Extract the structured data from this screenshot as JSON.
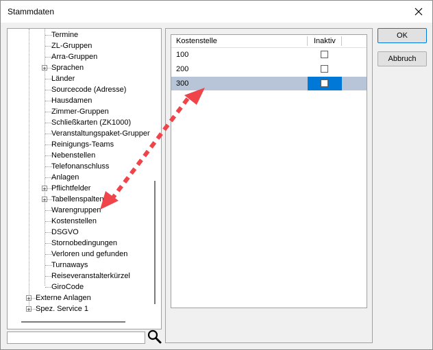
{
  "window": {
    "title": "Stammdaten"
  },
  "tree": {
    "items": [
      {
        "label": "Termine",
        "level": 2,
        "expander": false
      },
      {
        "label": "ZL-Gruppen",
        "level": 2,
        "expander": false
      },
      {
        "label": "Arra-Gruppen",
        "level": 2,
        "expander": false
      },
      {
        "label": "Sprachen",
        "level": 2,
        "expander": true
      },
      {
        "label": "Länder",
        "level": 2,
        "expander": false
      },
      {
        "label": "Sourcecode (Adresse)",
        "level": 2,
        "expander": false
      },
      {
        "label": "Hausdamen",
        "level": 2,
        "expander": false
      },
      {
        "label": "Zimmer-Gruppen",
        "level": 2,
        "expander": false
      },
      {
        "label": "Schließkarten (ZK1000)",
        "level": 2,
        "expander": false
      },
      {
        "label": "Veranstaltungspaket-Gruppen",
        "level": 2,
        "expander": false
      },
      {
        "label": "Reinigungs-Teams",
        "level": 2,
        "expander": false
      },
      {
        "label": "Nebenstellen",
        "level": 2,
        "expander": false
      },
      {
        "label": "Telefonanschluss",
        "level": 2,
        "expander": false
      },
      {
        "label": "Anlagen",
        "level": 2,
        "expander": false
      },
      {
        "label": "Pflichtfelder",
        "level": 2,
        "expander": true
      },
      {
        "label": "Tabellenspalten",
        "level": 2,
        "expander": true
      },
      {
        "label": "Warengruppen",
        "level": 2,
        "expander": false
      },
      {
        "label": "Kostenstellen",
        "level": 2,
        "expander": false
      },
      {
        "label": "DSGVO",
        "level": 2,
        "expander": false
      },
      {
        "label": "Stornobedingungen",
        "level": 2,
        "expander": false
      },
      {
        "label": "Verloren und gefunden",
        "level": 2,
        "expander": false
      },
      {
        "label": "Turnaways",
        "level": 2,
        "expander": false
      },
      {
        "label": "Reiseveranstalterkürzel",
        "level": 2,
        "expander": false
      },
      {
        "label": "GiroCode",
        "level": 2,
        "expander": false
      },
      {
        "label": "Externe Anlagen",
        "level": 1,
        "expander": true
      },
      {
        "label": "Spez. Service 1",
        "level": 1,
        "expander": true
      }
    ]
  },
  "search": {
    "value": ""
  },
  "grid": {
    "columns": [
      "Kostenstelle",
      "Inaktiv"
    ],
    "rows": [
      {
        "value": "100",
        "inaktiv": false,
        "selected": false
      },
      {
        "value": "200",
        "inaktiv": false,
        "selected": false
      },
      {
        "value": "300",
        "inaktiv": false,
        "selected": true
      }
    ]
  },
  "buttons": {
    "ok": "OK",
    "cancel": "Abbruch"
  },
  "colors": {
    "arrow": "#f0444b",
    "selection": "#b8c5d8",
    "accent": "#0078d7"
  },
  "icons": {
    "close": "close-icon",
    "search": "magnifier-icon",
    "expander": "plus-box-icon"
  }
}
